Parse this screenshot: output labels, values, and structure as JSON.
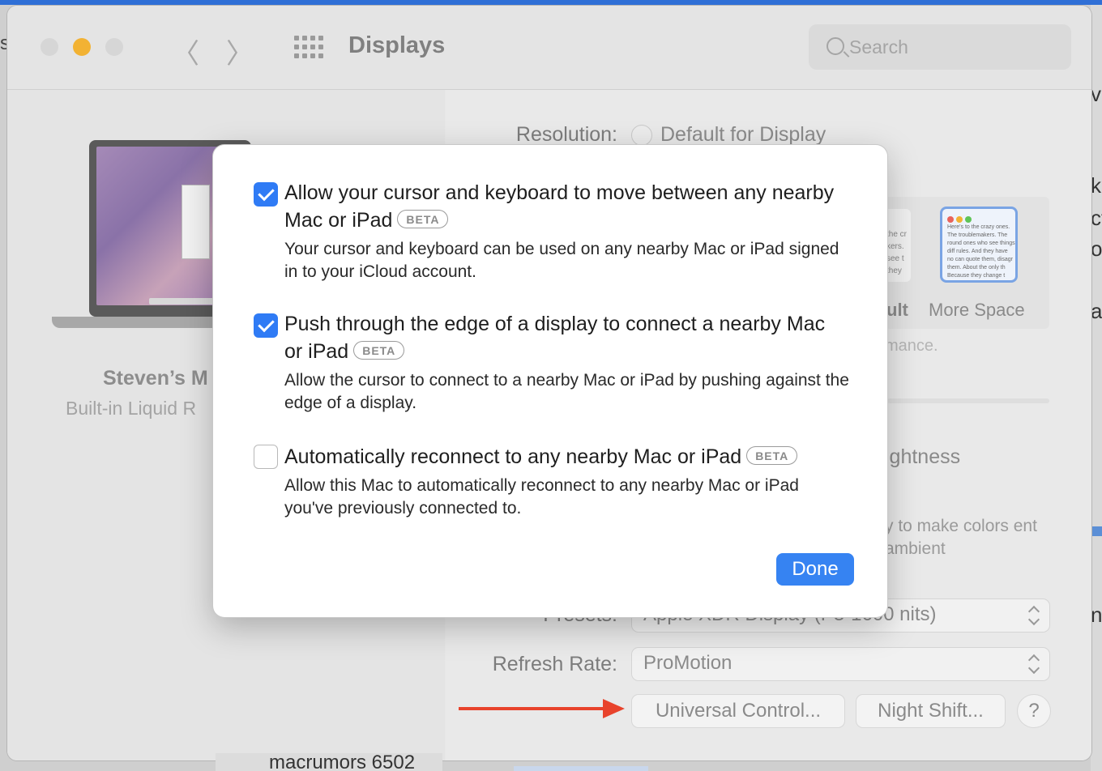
{
  "window": {
    "title": "Displays"
  },
  "toolbar": {
    "back_glyph": "〈",
    "forward_glyph": "〉"
  },
  "search": {
    "placeholder": "Search"
  },
  "sidebar": {
    "device_name": "Steven’s M",
    "device_subtitle": "Built-in Liquid R",
    "bottom_text": "macrumors 6502"
  },
  "content": {
    "resolution_label": "Resolution:",
    "resolution_value": "Default for Display",
    "thumb_default_text": "the cr kers. see t they",
    "thumb_default_caption": "ult",
    "thumb_more_text": "Here's to the crazy ones. The troublemakers. The round ones who see things diff rules. And they have no can quote them, disagr them. About the only th Because they change t",
    "thumb_more_caption": "More Space",
    "performance_text": "mance.",
    "brightness_text": "ightness",
    "colors_text": "y to make colors ent ambient",
    "presets_label": "Presets:",
    "presets_value": "Apple XDR Display (P3-1600 nits)",
    "refresh_label": "Refresh Rate:",
    "refresh_value": "ProMotion",
    "universal_control_button": "Universal Control...",
    "night_shift_button": "Night Shift...",
    "help_button": "?"
  },
  "dialog": {
    "options": [
      {
        "checked": true,
        "title": "Allow your cursor and keyboard to move between any nearby Mac or iPad",
        "badge": "BETA",
        "description": "Your cursor and keyboard can be used on any nearby Mac or iPad signed in to your iCloud account."
      },
      {
        "checked": true,
        "title": "Push through the edge of a display to connect a nearby Mac or iPad",
        "badge": "BETA",
        "description": "Allow the cursor to connect to a nearby Mac or iPad by pushing against the edge of a display."
      },
      {
        "checked": false,
        "title": "Automatically reconnect to any nearby Mac or iPad",
        "badge": "BETA",
        "description": "Allow this Mac to automatically reconnect to any nearby Mac or iPad you've previously connected to."
      }
    ],
    "done_button": "Done"
  },
  "desktop": {
    "left_edge_text": "s",
    "right_edge_text": [
      "ve",
      "k",
      "ct",
      "or",
      "as",
      "nt"
    ]
  },
  "colors": {
    "accent": "#2f7bf5",
    "annotation_arrow": "#e8432c",
    "minimize": "#f2b233"
  }
}
